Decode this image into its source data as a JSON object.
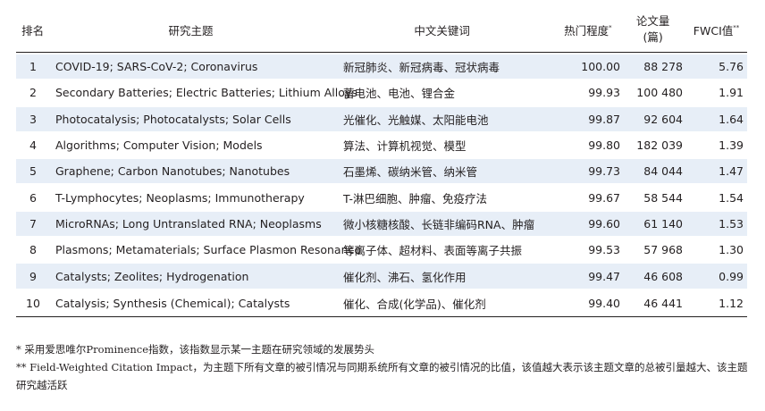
{
  "headers": {
    "rank": "排名",
    "topic": "研究主题",
    "keywords": "中文关键词",
    "hotness": "热门程度",
    "hotness_mark": "*",
    "pubs_line1": "论文量",
    "pubs_line2": "(篇)",
    "fwci": "FWCI值",
    "fwci_mark": "**"
  },
  "rows": [
    {
      "rank": "1",
      "topic": "COVID-19; SARS-CoV-2; Coronavirus",
      "keywords": "新冠肺炎、新冠病毒、冠状病毒",
      "hotness": "100.00",
      "pubs": "88 278",
      "fwci": "5.76"
    },
    {
      "rank": "2",
      "topic": "Secondary Batteries; Electric Batteries; Lithium Alloys",
      "keywords": "蓄电池、电池、锂合金",
      "hotness": "99.93",
      "pubs": "100 480",
      "fwci": "1.91"
    },
    {
      "rank": "3",
      "topic": "Photocatalysis; Photocatalysts; Solar Cells",
      "keywords": "光催化、光触媒、太阳能电池",
      "hotness": "99.87",
      "pubs": "92 604",
      "fwci": "1.64"
    },
    {
      "rank": "4",
      "topic": "Algorithms; Computer Vision; Models",
      "keywords": "算法、计算机视觉、模型",
      "hotness": "99.80",
      "pubs": "182 039",
      "fwci": "1.39"
    },
    {
      "rank": "5",
      "topic": "Graphene; Carbon Nanotubes; Nanotubes",
      "keywords": "石墨烯、碳纳米管、纳米管",
      "hotness": "99.73",
      "pubs": "84 044",
      "fwci": "1.47"
    },
    {
      "rank": "6",
      "topic": "T-Lymphocytes; Neoplasms; Immunotherapy",
      "keywords": "T-淋巴细胞、肿瘤、免疫疗法",
      "hotness": "99.67",
      "pubs": "58 544",
      "fwci": "1.54"
    },
    {
      "rank": "7",
      "topic": "MicroRNAs; Long Untranslated RNA; Neoplasms",
      "keywords": "微小核糖核酸、长链非编码RNA、肿瘤",
      "hotness": "99.60",
      "pubs": "61 140",
      "fwci": "1.53"
    },
    {
      "rank": "8",
      "topic": "Plasmons; Metamaterials; Surface Plasmon Resonance",
      "keywords": "等离子体、超材料、表面等离子共振",
      "hotness": "99.53",
      "pubs": "57 968",
      "fwci": "1.30"
    },
    {
      "rank": "9",
      "topic": "Catalysts; Zeolites; Hydrogenation",
      "keywords": "催化剂、沸石、氢化作用",
      "hotness": "99.47",
      "pubs": "46 608",
      "fwci": "0.99"
    },
    {
      "rank": "10",
      "topic": "Catalysis; Synthesis (Chemical); Catalysts",
      "keywords": "催化、合成(化学品)、催化剂",
      "hotness": "99.40",
      "pubs": "46 441",
      "fwci": "1.12"
    }
  ],
  "notes": [
    "* 采用爱思唯尔Prominence指数，该指数显示某一主题在研究领域的发展势头",
    "** Field-Weighted Citation Impact，为主题下所有文章的被引情况与同期系统所有文章的被引情况的比值，该值越大表示该主题文章的总被引量越大、该主题研究越活跃"
  ]
}
